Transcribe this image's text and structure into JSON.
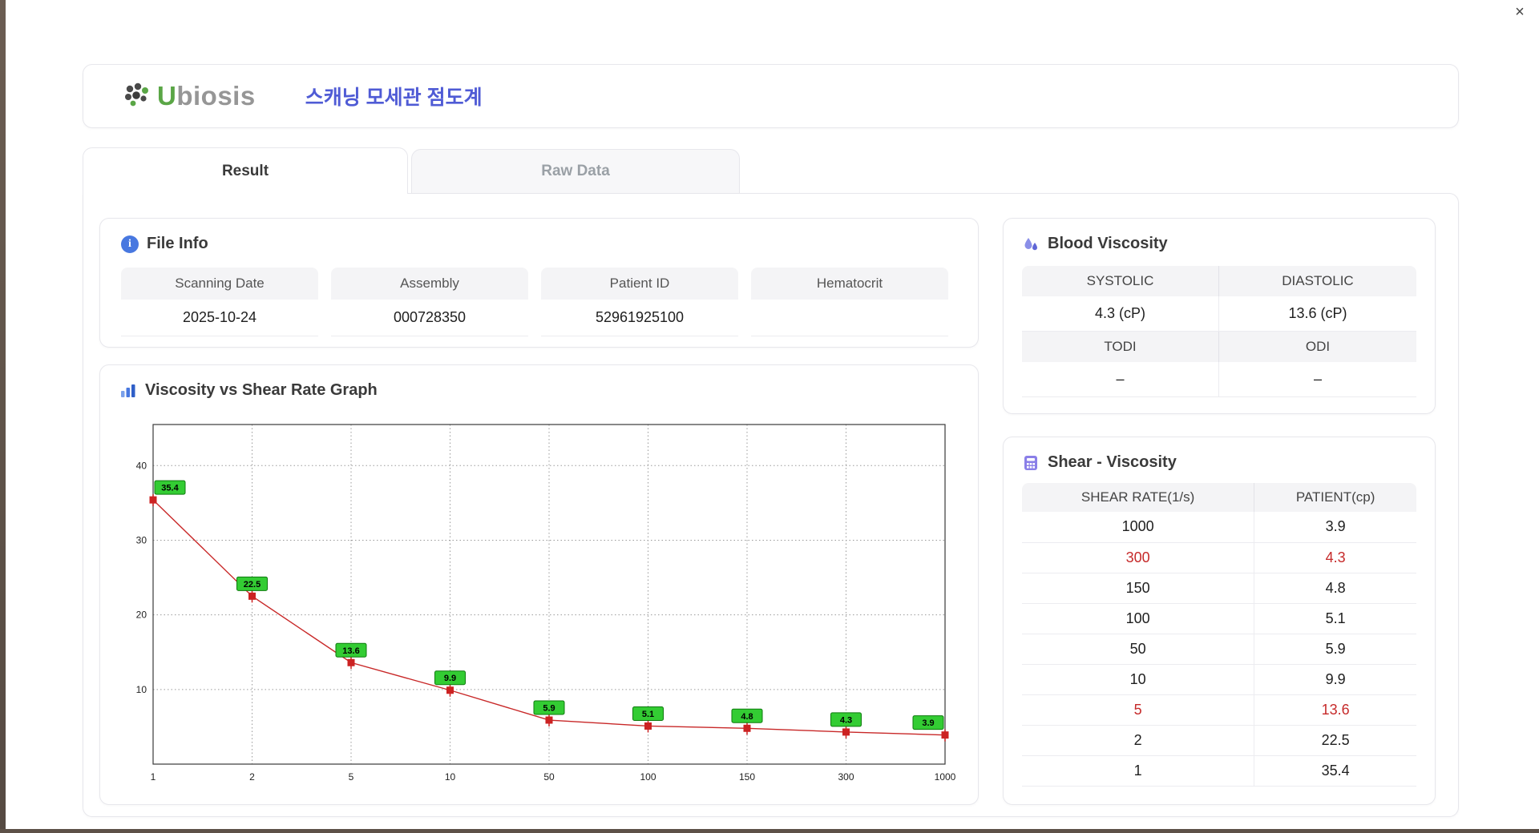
{
  "window": {
    "close": "×"
  },
  "header": {
    "logo_accent": "U",
    "logo_rest": "biosis",
    "title": "스캐닝 모세관 점도계"
  },
  "tabs": [
    {
      "label": "Result",
      "active": true
    },
    {
      "label": "Raw Data",
      "active": false
    }
  ],
  "file_info": {
    "title": "File Info",
    "fields": [
      {
        "label": "Scanning Date",
        "value": "2025-10-24"
      },
      {
        "label": "Assembly",
        "value": "000728350"
      },
      {
        "label": "Patient ID",
        "value": "52961925100"
      },
      {
        "label": "Hematocrit",
        "value": ""
      }
    ]
  },
  "blood_viscosity": {
    "title": "Blood Viscosity",
    "row1": [
      {
        "label": "SYSTOLIC",
        "value": "4.3 (cP)"
      },
      {
        "label": "DIASTOLIC",
        "value": "13.6 (cP)"
      }
    ],
    "row2": [
      {
        "label": "TODI",
        "value": "–"
      },
      {
        "label": "ODI",
        "value": "–"
      }
    ]
  },
  "graph": {
    "title": "Viscosity vs Shear Rate Graph"
  },
  "chart_data": {
    "type": "line",
    "title": "Viscosity vs Shear Rate Graph",
    "categories": [
      "1",
      "2",
      "5",
      "10",
      "50",
      "100",
      "150",
      "300",
      "1000"
    ],
    "values": [
      35.4,
      22.5,
      13.6,
      9.9,
      5.9,
      5.1,
      4.8,
      4.3,
      3.9
    ],
    "xlabel": "",
    "ylabel": "",
    "yticks": [
      10,
      20,
      30,
      40
    ],
    "ylim": [
      0,
      45.5
    ],
    "grid": true,
    "legend": "none",
    "line_color": "#c82828",
    "marker_color": "#cc2222",
    "label_bg": "#33cc33",
    "label_border": "#0d7a0d"
  },
  "shear_table": {
    "title": "Shear - Viscosity",
    "columns": [
      "SHEAR RATE(1/s)",
      "PATIENT(cp)"
    ],
    "rows": [
      {
        "shear": "1000",
        "patient": "3.9",
        "highlight": false
      },
      {
        "shear": "300",
        "patient": "4.3",
        "highlight": true
      },
      {
        "shear": "150",
        "patient": "4.8",
        "highlight": false
      },
      {
        "shear": "100",
        "patient": "5.1",
        "highlight": false
      },
      {
        "shear": "50",
        "patient": "5.9",
        "highlight": false
      },
      {
        "shear": "10",
        "patient": "9.9",
        "highlight": false
      },
      {
        "shear": "5",
        "patient": "13.6",
        "highlight": true
      },
      {
        "shear": "2",
        "patient": "22.5",
        "highlight": false
      },
      {
        "shear": "1",
        "patient": "35.4",
        "highlight": false
      }
    ]
  },
  "colors": {
    "accent_blue": "#4878e0",
    "title_blue": "#4f5bd5",
    "logo_green": "#5aa646",
    "highlight_red": "#c62a2a",
    "header_gray": "#f4f4f6"
  },
  "icons": {
    "info": "i",
    "droplet": "droplet-icon",
    "bar_chart": "bar-chart-icon",
    "calculator": "calculator-icon"
  }
}
